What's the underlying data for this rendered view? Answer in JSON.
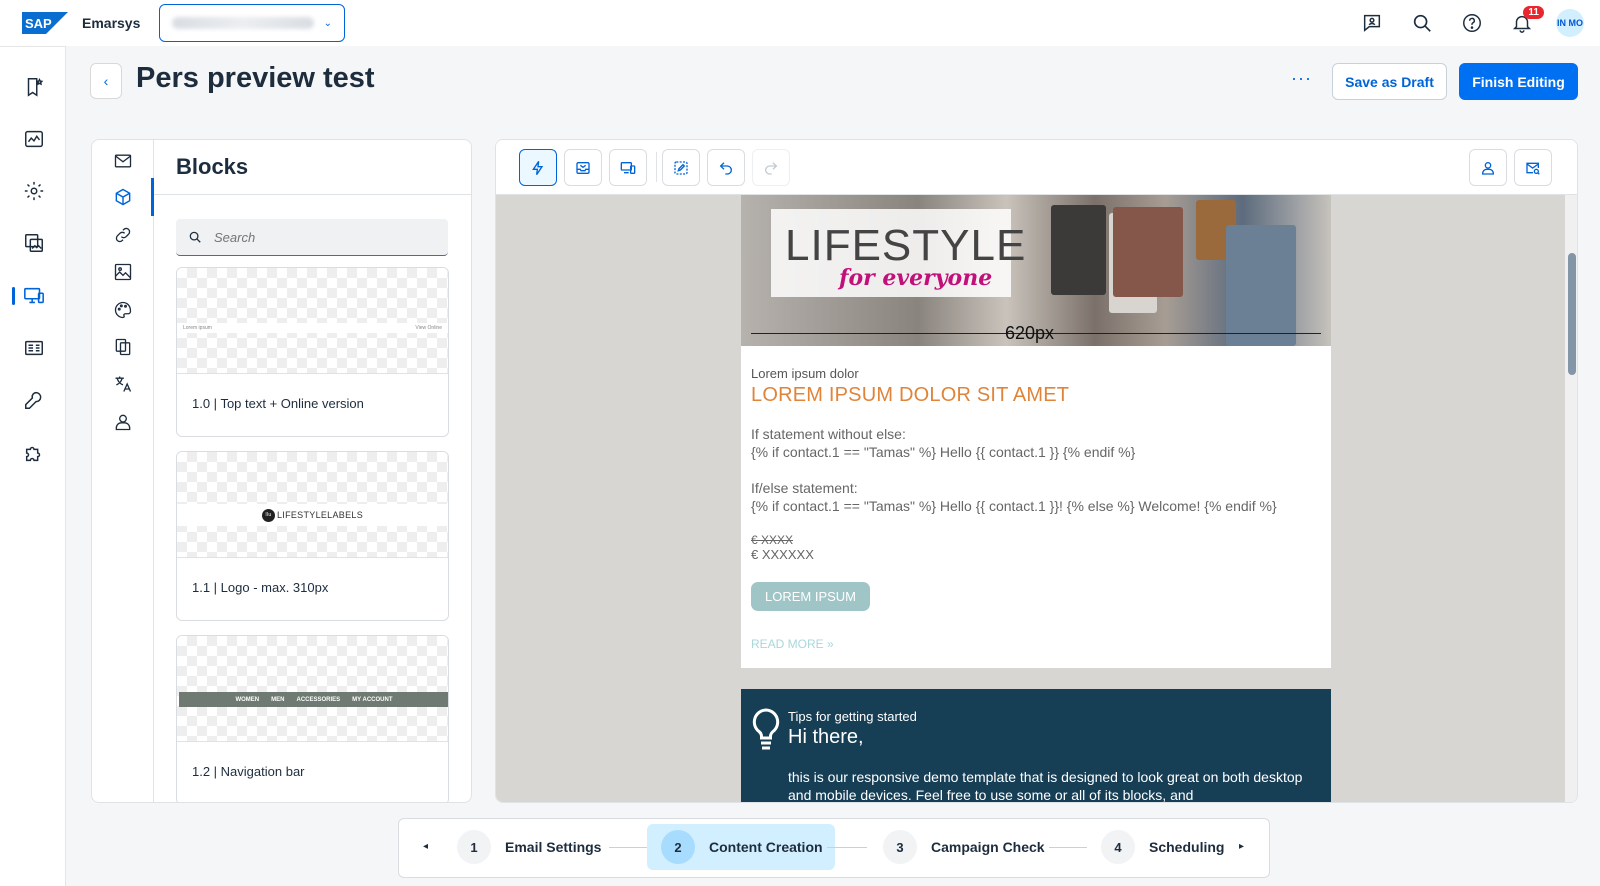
{
  "shell": {
    "logo_text": "SAP",
    "product_name": "Emarsys",
    "account_select_value": "",
    "notification_count": "11",
    "avatar_initials": "IN MO"
  },
  "header": {
    "title": "Pers preview test",
    "more_label": "···",
    "save_draft_label": "Save as Draft",
    "finish_label": "Finish Editing"
  },
  "rail": {
    "items": [
      "bookmark-star-icon",
      "analytics-icon",
      "settings-cog-icon",
      "images-icon",
      "devices-icon",
      "id-card-icon",
      "wrench-icon",
      "puzzle-icon"
    ],
    "active_index": 4
  },
  "blocks_panel": {
    "title": "Blocks",
    "search_placeholder": "Search",
    "tabs": [
      "mail-icon",
      "block-cube-icon",
      "link-icon",
      "image-icon",
      "palette-icon",
      "copy-icon",
      "translate-icon",
      "person-icon"
    ],
    "active_tab": 1,
    "cards": [
      {
        "label": "1.0 | Top text + Online version",
        "thumb_left": "Lorem ipsum",
        "thumb_right": "View Online"
      },
      {
        "label": "1.1 | Logo - max. 310px",
        "thumb_logo": "LIFESTYLELABELS",
        "thumb_mark": "llu"
      },
      {
        "label": "1.2 | Navigation bar",
        "thumb_nav": [
          "WOMEN",
          "MEN",
          "ACCESSORIES",
          "MY ACCOUNT"
        ]
      }
    ]
  },
  "editor": {
    "toolbar_left": [
      "flash-icon",
      "inbox-icon",
      "responsive-preview-icon",
      "edit-pencil-icon",
      "undo-icon",
      "redo-icon"
    ],
    "toolbar_right": [
      "person-preview-icon",
      "mail-search-icon"
    ],
    "email": {
      "hero_title": "LIFESTYLE",
      "hero_subtitle": "for everyone",
      "width_label": "620px",
      "kicker": "Lorem ipsum dolor",
      "heading": "LOREM IPSUM DOLOR SIT AMET",
      "if_label": "If statement without else:",
      "if_code": "{% if contact.1 == \"Tamas\" %} Hello {{ contact.1 }} {% endif %}",
      "ifelse_label": "If/else statement:",
      "ifelse_code": "{% if contact.1 == \"Tamas\" %} Hello {{ contact.1 }}! {% else %} Welcome! {% endif %}",
      "old_price": "€ XXXX",
      "price": "€ XXXXXX",
      "button_label": "LOREM IPSUM",
      "read_more": "READ MORE »"
    },
    "tips": {
      "kicker": "Tips for getting started",
      "heading": "Hi there,",
      "text": "this is our responsive demo template that is designed to look great on both desktop and mobile devices. Feel free to use some or all of its blocks, and"
    }
  },
  "stepper": {
    "prev_label": "◂",
    "next_label": "▸",
    "steps": [
      {
        "num": "1",
        "label": "Email Settings"
      },
      {
        "num": "2",
        "label": "Content Creation"
      },
      {
        "num": "3",
        "label": "Campaign Check"
      },
      {
        "num": "4",
        "label": "Scheduling"
      }
    ],
    "active_step": 2
  }
}
